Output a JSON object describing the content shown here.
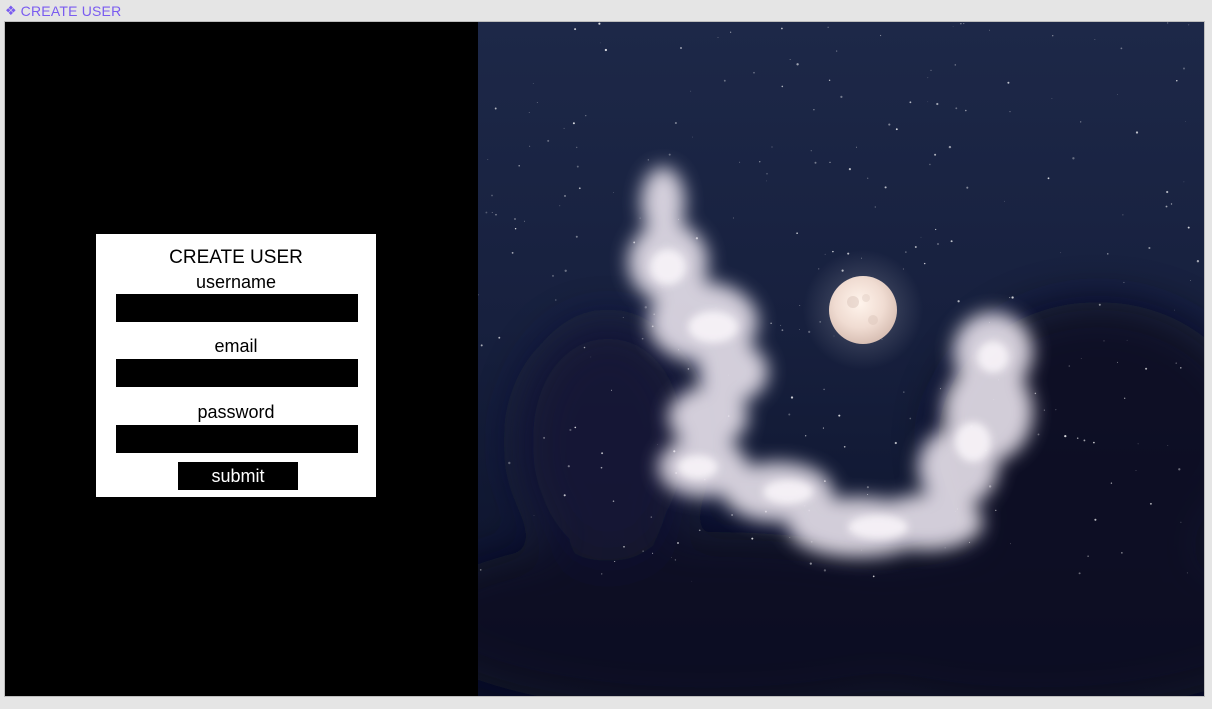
{
  "window": {
    "title": "CREATE USER",
    "icon": "app-diamond-icon",
    "accent_color": "#7a5cf0"
  },
  "form": {
    "title": "CREATE USER",
    "fields": [
      {
        "label": "username",
        "value": "",
        "type": "text"
      },
      {
        "label": "email",
        "value": "",
        "type": "email"
      },
      {
        "label": "password",
        "value": "",
        "type": "password"
      }
    ],
    "submit_label": "submit"
  },
  "background_image": {
    "subject": "night-sky-moon-clouds-image"
  }
}
